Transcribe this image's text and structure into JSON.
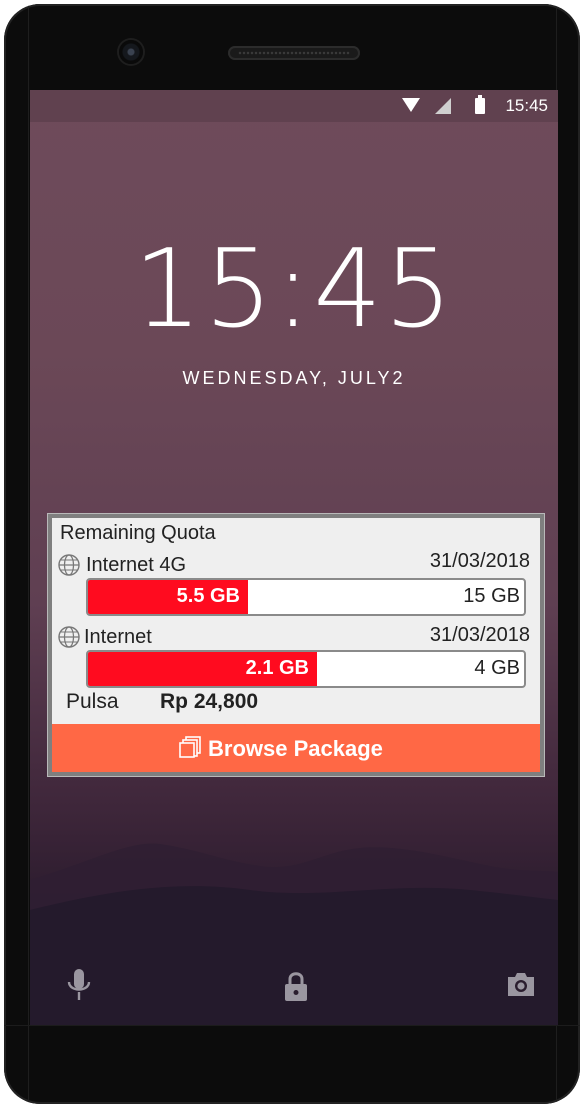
{
  "status_bar": {
    "time": "15:45",
    "icons": [
      "wifi-icon",
      "cell-signal-icon",
      "battery-icon"
    ]
  },
  "lockscreen": {
    "clock": "15:45",
    "date": "WEDNESDAY, JULY2"
  },
  "widget": {
    "title": "Remaining Quota",
    "rows": [
      {
        "label": "Internet 4G",
        "date": "31/03/2018",
        "used": "5.5 GB",
        "total": "15 GB",
        "fraction": 0.367
      },
      {
        "label": "Internet",
        "date": "31/03/2018",
        "used": "2.1 GB",
        "total": "4 GB",
        "fraction": 0.525
      }
    ],
    "pulsa_label": "Pulsa",
    "pulsa_value": "Rp 24,800",
    "browse_label": "Browse Package"
  },
  "bottom_icons": [
    "microphone-icon",
    "lock-icon",
    "camera-icon"
  ],
  "colors": {
    "bar_fill": "#ff0b1f",
    "browse_button": "#ff6845",
    "frame": "#0c0c0c"
  }
}
